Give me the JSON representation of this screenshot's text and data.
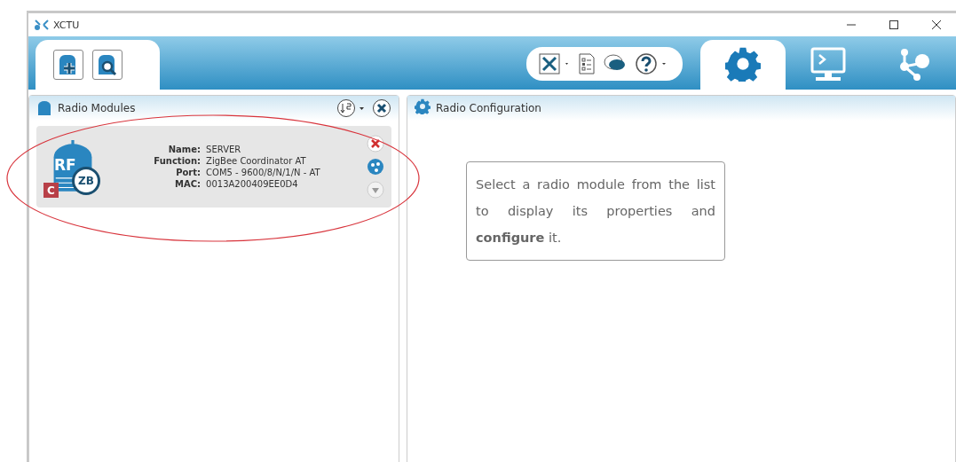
{
  "window": {
    "title": "XCTU"
  },
  "perspectives": [
    {
      "kind": "gear",
      "selected": true
    },
    {
      "kind": "console",
      "selected": false
    },
    {
      "kind": "network",
      "selected": false
    }
  ],
  "modules_panel": {
    "title": "Radio Modules",
    "module": {
      "badge": "C",
      "protocol": "ZB",
      "icon_text": "RF",
      "fields": [
        {
          "label": "Name:",
          "value": "SERVER"
        },
        {
          "label": "Function:",
          "value": "ZigBee Coordinator AT"
        },
        {
          "label": "Port:",
          "value": "COM5 - 9600/8/N/1/N - AT"
        },
        {
          "label": "MAC:",
          "value": "0013A200409EE0D4"
        }
      ]
    }
  },
  "config_panel": {
    "title": "Radio Configuration",
    "hint": "Select a radio module from the list to display its properties and **configure** it."
  },
  "annotation": {
    "kind": "ellipse",
    "color": "#d8343c"
  }
}
